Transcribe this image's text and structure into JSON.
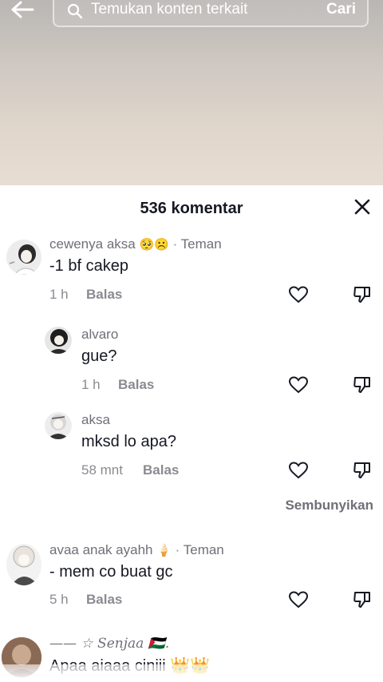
{
  "search": {
    "placeholder": "Temukan konten terkait",
    "submit_label": "Cari"
  },
  "comments_header": {
    "title": "536 komentar"
  },
  "comments": [
    {
      "username": "cewenya aksa",
      "emojis": "🥺☹️",
      "tag": "Teman",
      "text": "-1 bf cakep",
      "time": "1 h",
      "reply_label": "Balas"
    },
    {
      "username": "alvaro",
      "text": "gue?",
      "time": "1 h",
      "reply_label": "Balas"
    },
    {
      "username": "aksa",
      "text": "mksd lo apa?",
      "time": "58 mnt",
      "reply_label": "Balas"
    },
    {
      "username": "avaa anak ayahh",
      "emojis": "🍦",
      "tag": "Teman",
      "text": "- mem co buat gc",
      "time": "5 h",
      "reply_label": "Balas"
    },
    {
      "username": "—— ☆ Senjaa 🇵🇸.",
      "text": "Apaa aiaaa ciniii 👑👑"
    }
  ],
  "hide_replies_label": "Sembunyikan",
  "icons": {
    "back": "back-arrow-icon",
    "search": "search-icon",
    "close": "close-icon",
    "like": "heart-icon",
    "dislike": "thumbs-down-icon"
  }
}
